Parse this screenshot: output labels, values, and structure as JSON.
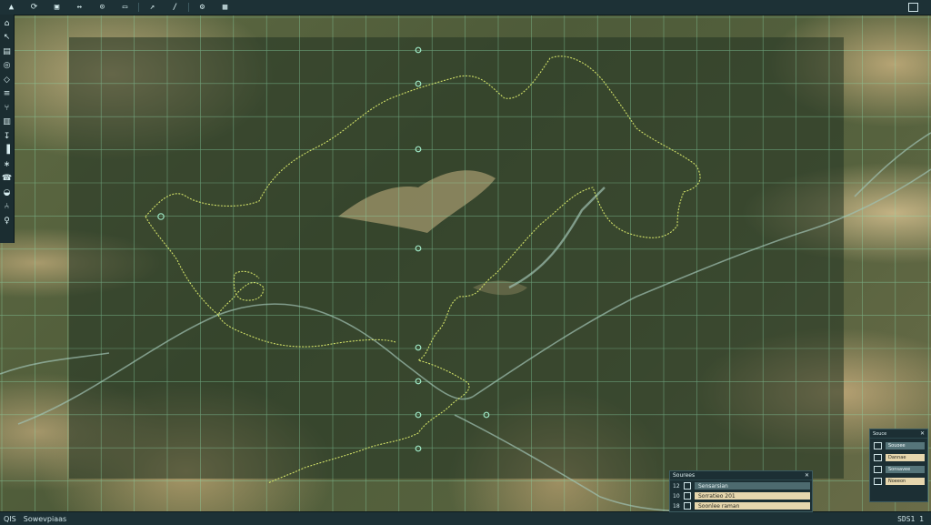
{
  "toolbar": {
    "items": [
      {
        "icon": "pan-icon",
        "glyph": "▲"
      },
      {
        "icon": "refresh-icon",
        "glyph": "⟳"
      },
      {
        "icon": "layers-icon",
        "glyph": "▣"
      },
      {
        "icon": "measure-icon",
        "glyph": "↔"
      },
      {
        "icon": "locate-icon",
        "glyph": "⊙"
      },
      {
        "icon": "screen-icon",
        "glyph": "▭"
      },
      {
        "icon": "export-icon",
        "glyph": "↗"
      },
      {
        "icon": "draw-icon",
        "glyph": "∕"
      },
      {
        "icon": "settings-icon",
        "glyph": "⚙"
      },
      {
        "icon": "grid-icon",
        "glyph": "▦"
      }
    ]
  },
  "tools": {
    "items": [
      {
        "icon": "home-icon",
        "glyph": "⌂"
      },
      {
        "icon": "select-icon",
        "glyph": "↖"
      },
      {
        "icon": "table-icon",
        "glyph": "▤"
      },
      {
        "icon": "target-icon",
        "glyph": "◎"
      },
      {
        "icon": "diamond-icon",
        "glyph": "◇"
      },
      {
        "icon": "list-icon",
        "glyph": "≡"
      },
      {
        "icon": "route-icon",
        "glyph": "⑂"
      },
      {
        "icon": "building-icon",
        "glyph": "▥"
      },
      {
        "icon": "plug-icon",
        "glyph": "↧"
      },
      {
        "icon": "chart-icon",
        "glyph": "▐"
      },
      {
        "icon": "node-icon",
        "glyph": "∗"
      },
      {
        "icon": "phone-icon",
        "glyph": "☎"
      },
      {
        "icon": "gauge-icon",
        "glyph": "◒"
      },
      {
        "icon": "fork-icon",
        "glyph": "⑃"
      },
      {
        "icon": "person-icon",
        "glyph": "♀"
      }
    ]
  },
  "layers_panel": {
    "title": "Sourees",
    "close_glyph": "✕",
    "rows": [
      {
        "num": "12",
        "label": "Sensarsian",
        "tone": "dark"
      },
      {
        "num": "10",
        "label": "Sorratieo 201",
        "tone": "light"
      },
      {
        "num": "18",
        "label": "Soonlee raman",
        "tone": "light"
      }
    ]
  },
  "side_panel": {
    "title": "Souce",
    "rows": [
      {
        "label": "Souoee",
        "tone": "dark"
      },
      {
        "label": "Dannae",
        "tone": "light"
      },
      {
        "label": "Sonsavee",
        "tone": "dark"
      },
      {
        "label": "Noeeon",
        "tone": "light"
      }
    ]
  },
  "status": {
    "crs": "QIS",
    "left_text": "Sowevpiaas",
    "right_text": "SDS1 1"
  },
  "colors": {
    "grid": "#8fe0b0",
    "boundary": "#d8e86a",
    "river": "#9fc0b2",
    "overlay": "#233322"
  }
}
